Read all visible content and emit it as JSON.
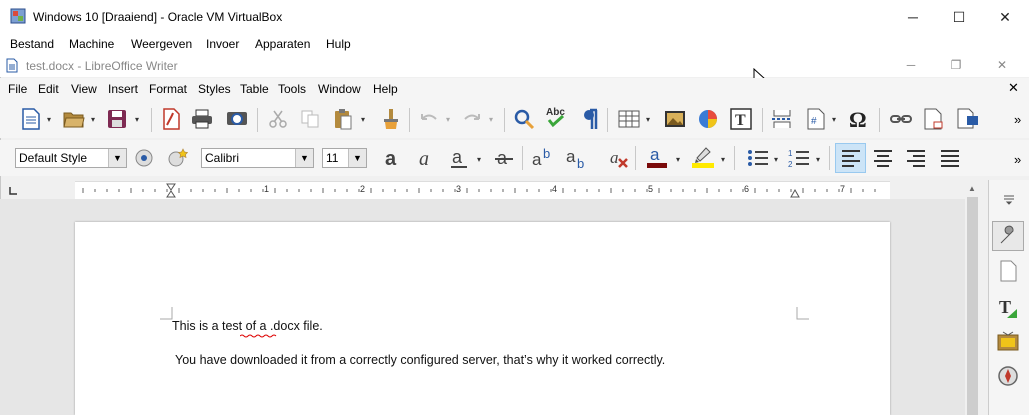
{
  "vbox": {
    "title": "Windows 10 [Draaiend] - Oracle VM VirtualBox",
    "controls": {
      "minimize": "─",
      "maximize": "☐",
      "close": "✕"
    },
    "menu": [
      "Bestand",
      "Machine",
      "Weergeven",
      "Invoer",
      "Apparaten",
      "Hulp"
    ]
  },
  "writer": {
    "title": "test.docx - LibreOffice Writer",
    "controls": {
      "minimize": "─",
      "restore": "❐",
      "close": "✕"
    },
    "doc_close": "✕",
    "menu": [
      "File",
      "Edit",
      "View",
      "Insert",
      "Format",
      "Styles",
      "Table",
      "Tools",
      "Window",
      "Help"
    ],
    "formatting": {
      "paragraph_style": "Default Style",
      "font_name": "Calibri",
      "font_size": "11"
    },
    "ruler_numbers": [
      "1",
      "2",
      "3",
      "4",
      "5",
      "6",
      "7"
    ],
    "overflow": "»",
    "document": {
      "lines": [
        "This is a test of a .docx file.",
        "You have downloaded it from a correctly configured server, that’s why it worked correctly."
      ]
    }
  }
}
